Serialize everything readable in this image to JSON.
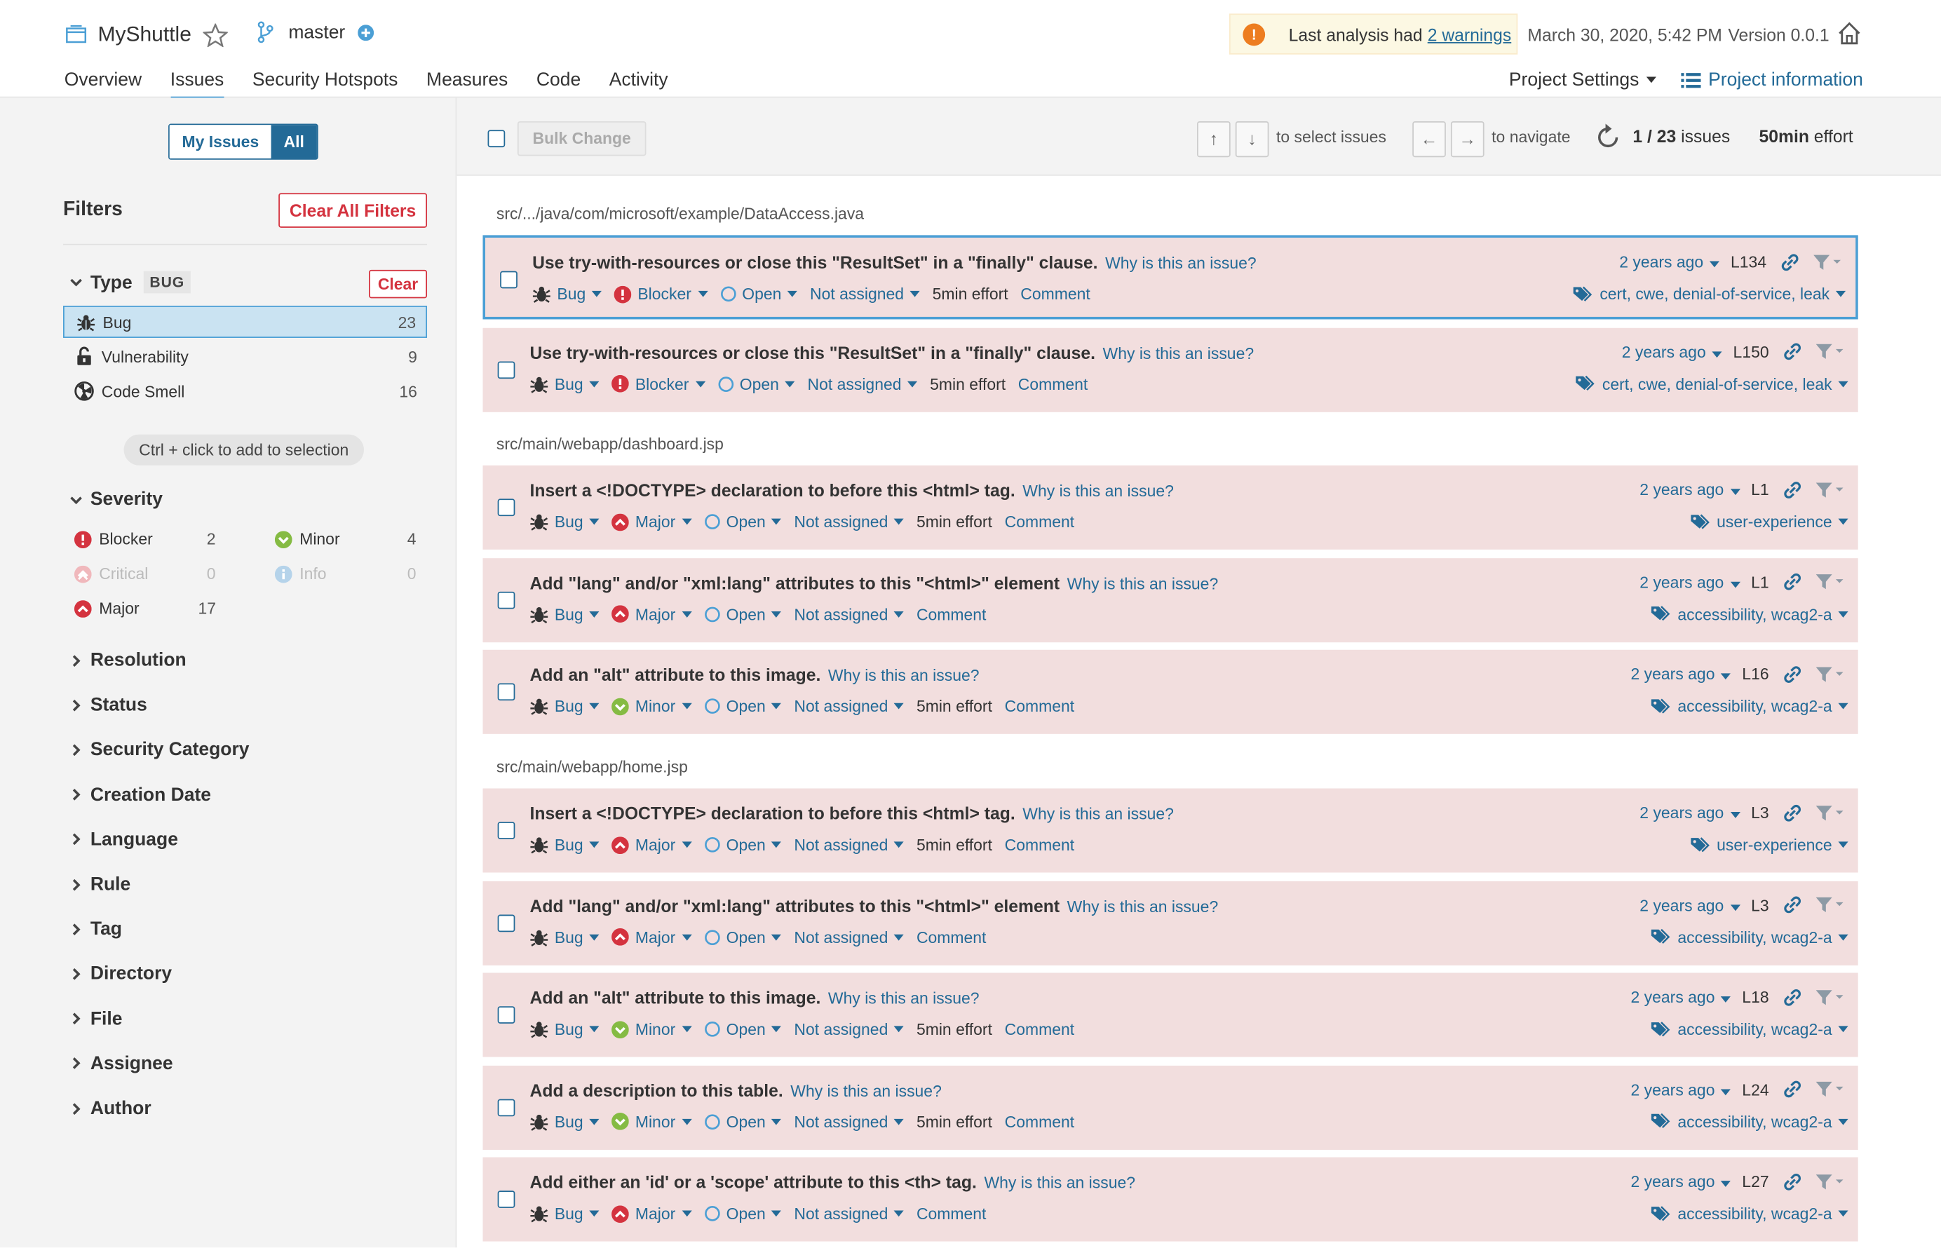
{
  "header": {
    "project": "MyShuttle",
    "branch": "master",
    "warning_prefix": "Last analysis had",
    "warning_link": "2 warnings",
    "date": "March 30, 2020, 5:42 PM",
    "version": "Version 0.0.1",
    "nav": [
      "Overview",
      "Issues",
      "Security Hotspots",
      "Measures",
      "Code",
      "Activity"
    ],
    "project_settings": "Project Settings",
    "project_information": "Project information"
  },
  "sidebar": {
    "my_issues": "My Issues",
    "all": "All",
    "filters_title": "Filters",
    "clear_all": "Clear All Filters",
    "type_label": "Type",
    "type_badge": "BUG",
    "clear": "Clear",
    "types": [
      {
        "label": "Bug",
        "count": "23"
      },
      {
        "label": "Vulnerability",
        "count": "9"
      },
      {
        "label": "Code Smell",
        "count": "16"
      }
    ],
    "hint": "Ctrl + click to add to selection",
    "severity_label": "Severity",
    "severities": [
      {
        "label": "Blocker",
        "count": "2"
      },
      {
        "label": "Minor",
        "count": "4"
      },
      {
        "label": "Critical",
        "count": "0"
      },
      {
        "label": "Info",
        "count": "0"
      },
      {
        "label": "Major",
        "count": "17"
      }
    ],
    "sections": [
      "Resolution",
      "Status",
      "Security Category",
      "Creation Date",
      "Language",
      "Rule",
      "Tag",
      "Directory",
      "File",
      "Assignee",
      "Author"
    ]
  },
  "toolbar": {
    "bulk_change": "Bulk Change",
    "up": "↑",
    "down": "↓",
    "select_text": "to select issues",
    "left": "←",
    "right": "→",
    "navigate_text": "to navigate",
    "count": "1 / 23",
    "count_suffix": "issues",
    "effort": "50min",
    "effort_suffix": "effort"
  },
  "colors": {
    "accent": "#236a97",
    "issue_bg": "#f2dede",
    "blocker": "#d4333f",
    "minor": "#85bb43"
  },
  "common": {
    "why": "Why is this an issue?",
    "open": "Open",
    "not_assigned": "Not assigned",
    "comment": "Comment",
    "age": "2 years ago",
    "type": "Bug"
  },
  "files": [
    {
      "path": "src/.../java/com/microsoft/example/DataAccess.java",
      "issues": [
        {
          "message": "Use try-with-resources or close this \"ResultSet\" in a \"finally\" clause.",
          "severity": "Blocker",
          "effort": "5min effort",
          "line": "L134",
          "tags": "cert, cwe, denial-of-service, leak"
        },
        {
          "message": "Use try-with-resources or close this \"ResultSet\" in a \"finally\" clause.",
          "severity": "Blocker",
          "effort": "5min effort",
          "line": "L150",
          "tags": "cert, cwe, denial-of-service, leak"
        }
      ]
    },
    {
      "path": "src/main/webapp/dashboard.jsp",
      "issues": [
        {
          "message": "Insert a <!DOCTYPE> declaration to before this <html> tag.",
          "severity": "Major",
          "effort": "5min effort",
          "line": "L1",
          "tags": "user-experience"
        },
        {
          "message": "Add \"lang\" and/or \"xml:lang\" attributes to this \"<html>\" element",
          "severity": "Major",
          "effort": "",
          "line": "L1",
          "tags": "accessibility, wcag2-a"
        },
        {
          "message": "Add an \"alt\" attribute to this image.",
          "severity": "Minor",
          "effort": "5min effort",
          "line": "L16",
          "tags": "accessibility, wcag2-a"
        }
      ]
    },
    {
      "path": "src/main/webapp/home.jsp",
      "issues": [
        {
          "message": "Insert a <!DOCTYPE> declaration to before this <html> tag.",
          "severity": "Major",
          "effort": "5min effort",
          "line": "L3",
          "tags": "user-experience"
        },
        {
          "message": "Add \"lang\" and/or \"xml:lang\" attributes to this \"<html>\" element",
          "severity": "Major",
          "effort": "",
          "line": "L3",
          "tags": "accessibility, wcag2-a"
        },
        {
          "message": "Add an \"alt\" attribute to this image.",
          "severity": "Minor",
          "effort": "5min effort",
          "line": "L18",
          "tags": "accessibility, wcag2-a"
        },
        {
          "message": "Add a description to this table.",
          "severity": "Minor",
          "effort": "5min effort",
          "line": "L24",
          "tags": "accessibility, wcag2-a"
        },
        {
          "message": "Add either an 'id' or a 'scope' attribute to this <th> tag.",
          "severity": "Major",
          "effort": "",
          "line": "L27",
          "tags": "accessibility, wcag2-a"
        }
      ]
    }
  ]
}
